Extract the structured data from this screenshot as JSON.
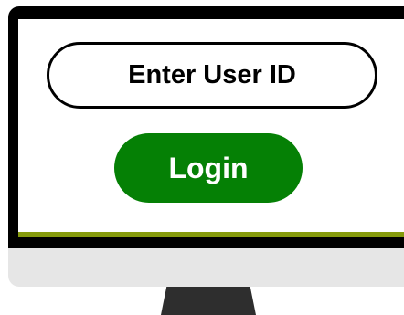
{
  "login_form": {
    "userid_placeholder": "Enter User ID",
    "login_label": "Login"
  },
  "colors": {
    "login_button": "#058005",
    "screen_accent": "#859a0c",
    "bezel": "#000000",
    "chin": "#e6e6e6",
    "stand": "#2e2e2e"
  }
}
